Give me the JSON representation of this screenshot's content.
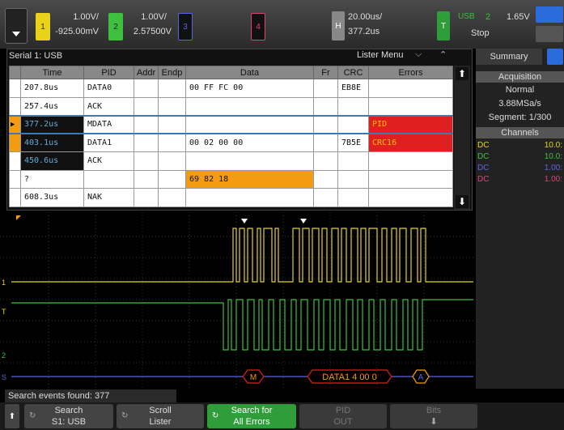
{
  "colors": {
    "ch1": "#e8d21a",
    "ch2": "#3fbf3f",
    "ch3": "#5a66e0",
    "ch4": "#e0407a",
    "accent": "#2a6cdb",
    "error": "#e02020",
    "marker": "#f39c12"
  },
  "topbar": {
    "ch1": {
      "num": "1",
      "scale": "1.00V/",
      "offset": "-925.00mV"
    },
    "ch2": {
      "num": "2",
      "scale": "1.00V/",
      "offset": "2.57500V"
    },
    "ch3": {
      "num": "3"
    },
    "ch4": {
      "num": "4"
    },
    "horizontal": {
      "badge": "H",
      "scale": "20.00us/",
      "delay": "377.2us"
    },
    "trigger": {
      "badge": "T",
      "source": "USB",
      "channel": "2",
      "level": "1.65V",
      "mode": "Stop"
    }
  },
  "lister": {
    "title": "Serial 1: USB",
    "menu_label": "Lister Menu",
    "columns": [
      "",
      "Time",
      "PID",
      "Addr",
      "Endp",
      "Data",
      "Fr",
      "CRC",
      "Errors"
    ],
    "rows": [
      {
        "time": "207.8us",
        "pid": "DATA0",
        "addr": "",
        "endp": "",
        "data": "00 FF FC 00",
        "fr": "",
        "crc": "EB8E",
        "errors": ""
      },
      {
        "time": "257.4us",
        "pid": "ACK",
        "addr": "",
        "endp": "",
        "data": "",
        "fr": "",
        "crc": "",
        "errors": ""
      },
      {
        "time": "377.2us",
        "pid": "MDATA",
        "addr": "",
        "endp": "",
        "data": "",
        "fr": "",
        "crc": "",
        "errors": "PID"
      },
      {
        "time": "403.1us",
        "pid": "DATA1",
        "addr": "",
        "endp": "",
        "data": "00 02 00 00",
        "fr": "",
        "crc": "7B5E",
        "errors": "CRC16"
      },
      {
        "time": "450.6us",
        "pid": "ACK",
        "addr": "",
        "endp": "",
        "data": "",
        "fr": "",
        "crc": "",
        "errors": ""
      },
      {
        "time": "?",
        "pid": "",
        "addr": "",
        "endp": "",
        "data": "69 82 18",
        "fr": "",
        "crc": "",
        "errors": ""
      },
      {
        "time": "608.3us",
        "pid": "NAK",
        "addr": "",
        "endp": "",
        "data": "",
        "fr": "",
        "crc": "",
        "errors": ""
      }
    ]
  },
  "summary": {
    "tab": "Summary",
    "acquisition_header": "Acquisition",
    "acq_mode": "Normal",
    "sample_rate": "3.88MSa/s",
    "segment": "Segment: 1/300",
    "channels_header": "Channels",
    "channels": [
      {
        "coupling": "DC",
        "probe": "10.0:"
      },
      {
        "coupling": "DC",
        "probe": "10.0:"
      },
      {
        "coupling": "DC",
        "probe": "1.00:"
      },
      {
        "coupling": "DC",
        "probe": "1.00:"
      }
    ]
  },
  "scope": {
    "markers": {
      "ch1": "1",
      "trigger": "T",
      "ch2": "2",
      "serial": "S"
    },
    "decode": {
      "packet1": "M",
      "packet2": "DATA1  4  00  0",
      "packet3": "A"
    }
  },
  "search_status": "Search events found: 377",
  "softkeys": [
    {
      "line1": "Search",
      "line2": "S1: USB"
    },
    {
      "line1": "Scroll",
      "line2": "Lister"
    },
    {
      "line1": "Search for",
      "line2": "All Errors"
    },
    {
      "line1": "PID",
      "line2": "OUT"
    },
    {
      "line1": "Bits",
      "line2": ""
    }
  ]
}
